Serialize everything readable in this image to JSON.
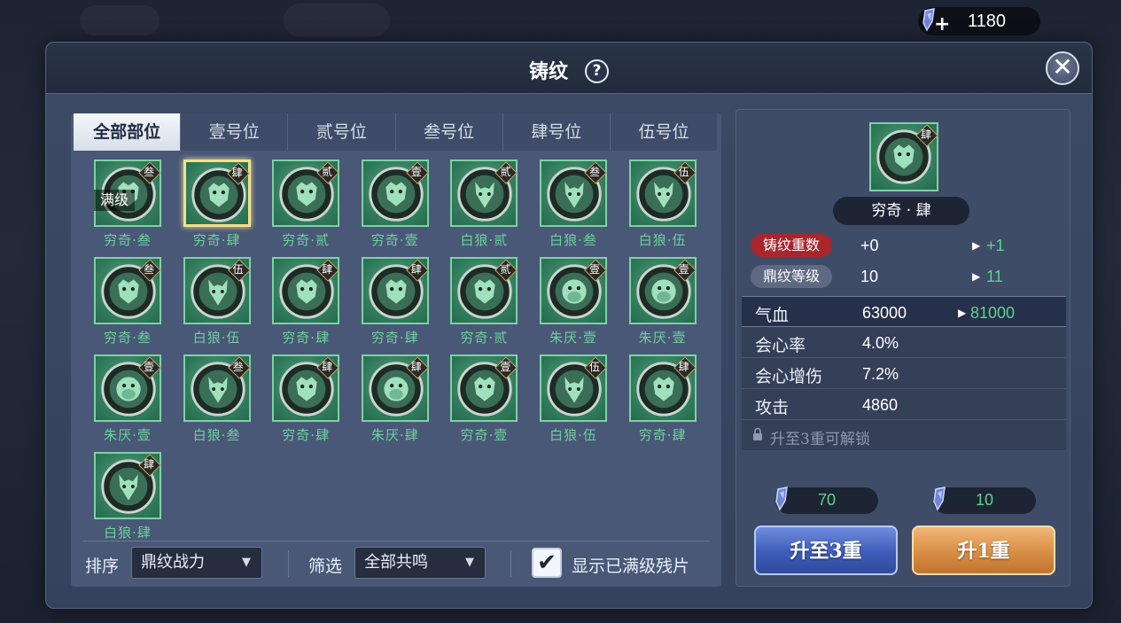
{
  "currency": {
    "amount": "1180",
    "plus": "+",
    "icon": "spirit-crystal-icon"
  },
  "dialog": {
    "title": "铸纹",
    "help": "?",
    "close": "✕"
  },
  "tabs": [
    {
      "label": "全部部位",
      "active": true
    },
    {
      "label": "壹号位",
      "active": false
    },
    {
      "label": "贰号位",
      "active": false
    },
    {
      "label": "叁号位",
      "active": false
    },
    {
      "label": "肆号位",
      "active": false
    },
    {
      "label": "伍号位",
      "active": false
    }
  ],
  "items": [
    {
      "name": "穷奇·叁",
      "badge": "叁",
      "beast": "tiger",
      "maxed": "满级"
    },
    {
      "name": "穷奇·肆",
      "badge": "肆",
      "beast": "tiger",
      "selected": true
    },
    {
      "name": "穷奇·贰",
      "badge": "贰",
      "beast": "tiger"
    },
    {
      "name": "穷奇·壹",
      "badge": "壹",
      "beast": "tiger"
    },
    {
      "name": "白狼·贰",
      "badge": "贰",
      "beast": "wolf"
    },
    {
      "name": "白狼·叁",
      "badge": "叁",
      "beast": "wolf"
    },
    {
      "name": "白狼·伍",
      "badge": "伍",
      "beast": "wolf"
    },
    {
      "name": "穷奇·叁",
      "badge": "叁",
      "beast": "tiger"
    },
    {
      "name": "白狼·伍",
      "badge": "伍",
      "beast": "wolf"
    },
    {
      "name": "穷奇·肆",
      "badge": "肆",
      "beast": "tiger"
    },
    {
      "name": "穷奇·肆",
      "badge": "肆",
      "beast": "tiger"
    },
    {
      "name": "穷奇·贰",
      "badge": "贰",
      "beast": "tiger"
    },
    {
      "name": "朱厌·壹",
      "badge": "壹",
      "beast": "ape"
    },
    {
      "name": "朱厌·壹",
      "badge": "壹",
      "beast": "ape"
    },
    {
      "name": "朱厌·壹",
      "badge": "壹",
      "beast": "ape"
    },
    {
      "name": "白狼·叁",
      "badge": "叁",
      "beast": "wolf"
    },
    {
      "name": "穷奇·肆",
      "badge": "肆",
      "beast": "tiger"
    },
    {
      "name": "朱厌·肆",
      "badge": "肆",
      "beast": "ape"
    },
    {
      "name": "穷奇·壹",
      "badge": "壹",
      "beast": "tiger"
    },
    {
      "name": "白狼·伍",
      "badge": "伍",
      "beast": "wolf"
    },
    {
      "name": "穷奇·肆",
      "badge": "肆",
      "beast": "tiger"
    },
    {
      "name": "白狼·肆",
      "badge": "肆",
      "beast": "wolf"
    }
  ],
  "bottom": {
    "sort_label": "排序",
    "sort_value": "鼎纹战力",
    "filter_label": "筛选",
    "filter_value": "全部共鸣",
    "check_mark": "✔",
    "show_maxed_label": "显示已满级残片"
  },
  "detail": {
    "badge": "肆",
    "name": "穷奇 · 肆",
    "rows": [
      {
        "tag": "铸纹重数",
        "value": "+0",
        "new": "+1",
        "arrow": "▶"
      },
      {
        "tag": "鼎纹等级",
        "value": "10",
        "new": "11",
        "arrow": "▶"
      }
    ],
    "stats": [
      {
        "name": "气血",
        "value": "63000",
        "new": "81000",
        "arrow": "▶"
      },
      {
        "name": "会心率",
        "value": "4.0%"
      },
      {
        "name": "会心增伤",
        "value": "7.2%"
      },
      {
        "name": "攻击",
        "value": "4860"
      }
    ],
    "lock_text": "升至3重可解锁",
    "costs": [
      "70",
      "10"
    ],
    "btn_upgrade3": "升至3重",
    "btn_upgrade1": "升1重"
  },
  "colors": {
    "accent_green": "#5ed28d",
    "item_name_green": "#6ad39a",
    "tag_red": "#a8262c",
    "selected_gold": "#f3e08a"
  }
}
